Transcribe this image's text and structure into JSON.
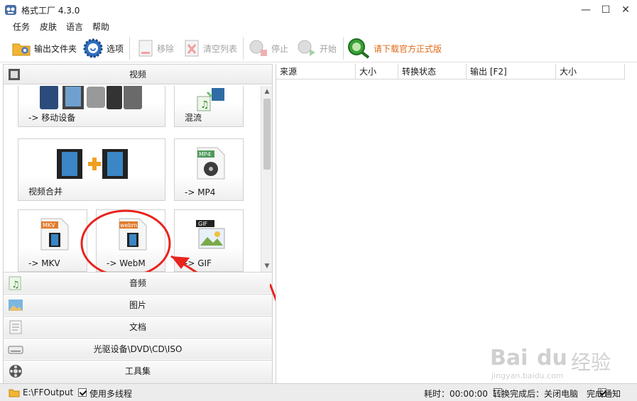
{
  "window": {
    "title": "格式工厂 4.3.0",
    "app_icon": "format-factory-logo",
    "controls": {
      "minimize": "—",
      "maximize": "☐",
      "close": "✕"
    }
  },
  "menu": [
    "任务",
    "皮肤",
    "语言",
    "帮助"
  ],
  "toolbar": {
    "output_folder": "输出文件夹",
    "options": "选项",
    "remove": "移除",
    "clear_list": "清空列表",
    "stop": "停止",
    "start": "开始",
    "download": "请下载官方正式版",
    "accent_orange": "#e06a1a"
  },
  "left_panel": {
    "video_header": "视频",
    "tiles": [
      "-> 移动设备",
      "混流",
      "视频合并",
      "-> MP4",
      "-> MKV",
      "-> WebM",
      "-> GIF"
    ],
    "tile_badges": {
      "mp4": "MP4",
      "mkv": "MKV",
      "webm": "webm",
      "gif": "GIF"
    },
    "categories": [
      "音频",
      "图片",
      "文档",
      "光驱设备\\DVD\\CD\\ISO",
      "工具集"
    ]
  },
  "task_table": {
    "columns": [
      "来源",
      "大小",
      "转换状态",
      "输出 [F2]",
      "大小"
    ]
  },
  "status_bar": {
    "output_path": "E:\\FFOutput",
    "multithread": "使用多线程",
    "elapsed": "耗时：00:00:00",
    "after_convert": "转换完成后：关闭电脑",
    "notify": "完成通知"
  },
  "annotation": {
    "highlight_color": "#e8231c"
  },
  "watermark": {
    "brand": "Bai",
    "brand2": "du",
    "cn": "经验",
    "url": "jingyan.baidu.com"
  }
}
